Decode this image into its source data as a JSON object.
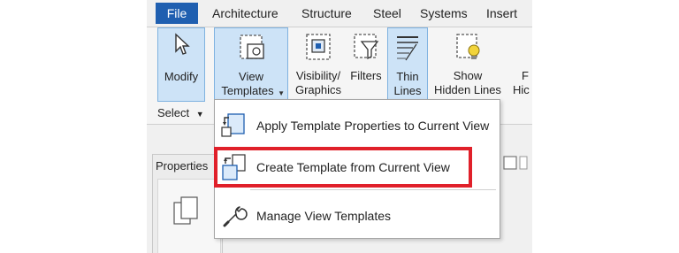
{
  "tabs": [
    "File",
    "Architecture",
    "Structure",
    "Steel",
    "Systems",
    "Insert"
  ],
  "ribbon": {
    "modify": {
      "label": "Modify"
    },
    "view_templates": {
      "line1": "View",
      "line2": "Templates"
    },
    "visibility_graphics": {
      "line1": "Visibility/",
      "line2": "Graphics"
    },
    "filters": {
      "line1": "Filters"
    },
    "thin_lines": {
      "line1": "Thin",
      "line2": "Lines"
    },
    "show_hidden_lines": {
      "line1": "Show",
      "line2": "Hidden Lines"
    },
    "partial": {
      "line1": "F",
      "line2": "Hic"
    },
    "select": {
      "label": "Select"
    }
  },
  "properties": {
    "label": "Properties"
  },
  "menu": {
    "items": [
      {
        "label": "Apply Template Properties to Current View",
        "icon": "apply-template-icon"
      },
      {
        "label": "Create Template from Current View",
        "icon": "create-template-icon",
        "highlighted": true
      },
      {
        "label": "Manage View Templates",
        "icon": "wrench-icon"
      }
    ]
  },
  "colors": {
    "file_tab": "#1f5fb0",
    "active_button": "#cde3f7",
    "highlight_border": "#e0202a"
  }
}
